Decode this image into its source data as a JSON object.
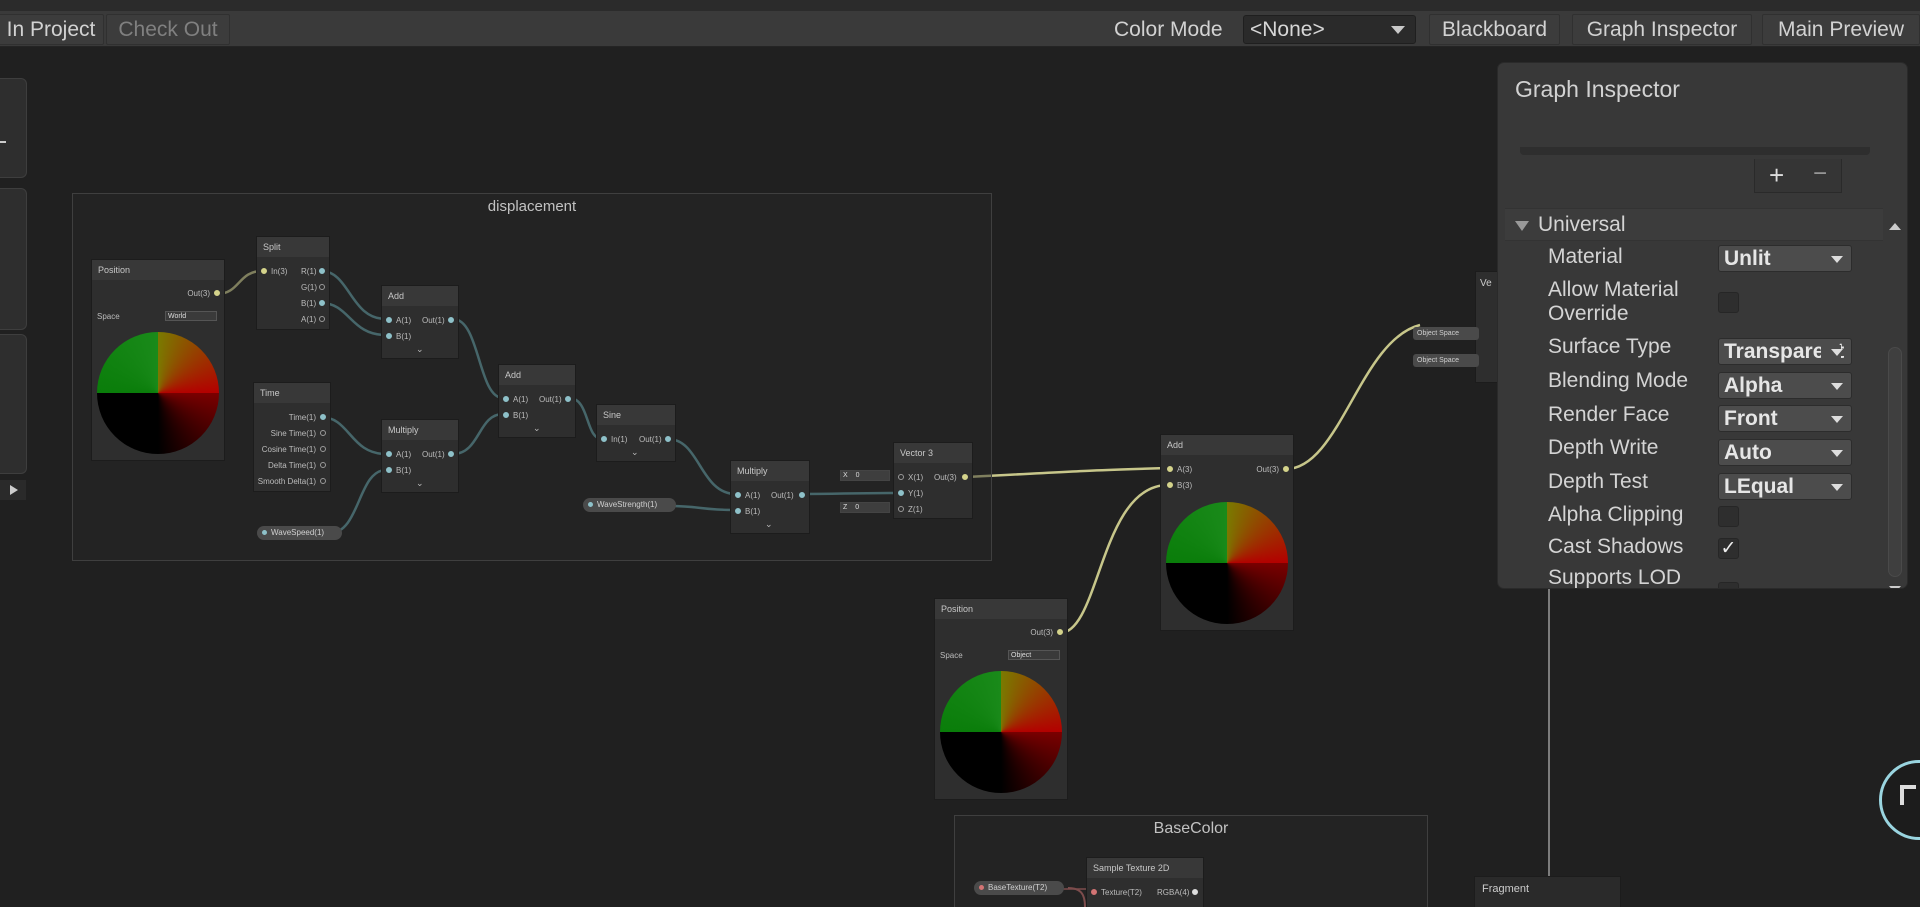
{
  "toolbar": {
    "save_in_project": "In Project",
    "check_out": "Check Out",
    "color_mode_label": "Color Mode",
    "color_mode_value": "<None>",
    "blackboard": "Blackboard",
    "graph_inspector": "Graph Inspector",
    "main_preview": "Main Preview"
  },
  "groups": {
    "displacement": "displacement",
    "basecolor": "BaseColor"
  },
  "nodes": {
    "position1": {
      "title": "Position",
      "out": "Out(3)",
      "space_label": "Space",
      "space_value": "World"
    },
    "split": {
      "title": "Split",
      "in": "In(3)",
      "outs": [
        "R(1)",
        "G(1)",
        "B(1)",
        "A(1)"
      ]
    },
    "add1": {
      "title": "Add",
      "a": "A(1)",
      "b": "B(1)",
      "out": "Out(1)"
    },
    "time": {
      "title": "Time",
      "outs": [
        "Time(1)",
        "Sine Time(1)",
        "Cosine Time(1)",
        "Delta Time(1)",
        "Smooth Delta(1)"
      ]
    },
    "multiply1": {
      "title": "Multiply",
      "a": "A(1)",
      "b": "B(1)",
      "out": "Out(1)"
    },
    "add2": {
      "title": "Add",
      "a": "A(1)",
      "b": "B(1)",
      "out": "Out(1)"
    },
    "sine": {
      "title": "Sine",
      "in": "In(1)",
      "out": "Out(1)"
    },
    "multiply2": {
      "title": "Multiply",
      "a": "A(1)",
      "b": "B(1)",
      "out": "Out(1)"
    },
    "vector3": {
      "title": "Vector 3",
      "x": "X(1)",
      "y": "Y(1)",
      "z": "Z(1)",
      "out": "Out(3)",
      "x_label": "X",
      "x_value": "0",
      "z_label": "Z",
      "z_value": "0"
    },
    "wavespeed": "WaveSpeed(1)",
    "wavestrength": "WaveStrength(1)",
    "position2": {
      "title": "Position",
      "out": "Out(3)",
      "space_label": "Space",
      "space_value": "Object"
    },
    "add3": {
      "title": "Add",
      "a": "A(3)",
      "b": "B(3)",
      "out": "Out(3)"
    },
    "vertex_partial": "Ve",
    "object_space_1": "Object Space",
    "object_space_2": "Object Space",
    "sample_texture": {
      "title": "Sample Texture 2D",
      "texture": "Texture(T2)",
      "rgba": "RGBA(4)"
    },
    "basetexture": "BaseTexture(T2)",
    "fragment": "Fragment"
  },
  "inspector": {
    "title": "Graph Inspector",
    "section": "Universal",
    "add": "+",
    "remove": "−",
    "rows": [
      {
        "label": "Material",
        "value": "Unlit",
        "kind": "dropdown"
      },
      {
        "label": "Allow Material",
        "label2": "Override",
        "checked": false,
        "kind": "checkbox"
      },
      {
        "label": "Surface Type",
        "value": "Transparent",
        "kind": "dropdown"
      },
      {
        "label": "Blending Mode",
        "value": "Alpha",
        "kind": "dropdown"
      },
      {
        "label": "Render Face",
        "value": "Front",
        "kind": "dropdown"
      },
      {
        "label": "Depth Write",
        "value": "Auto",
        "kind": "dropdown"
      },
      {
        "label": "Depth Test",
        "value": "LEqual",
        "kind": "dropdown"
      },
      {
        "label": "Alpha Clipping",
        "checked": false,
        "kind": "checkbox"
      },
      {
        "label": "Cast Shadows",
        "checked": true,
        "check_mark": "✓",
        "kind": "checkbox"
      },
      {
        "label": "Supports LOD",
        "checked": false,
        "kind": "checkbox"
      }
    ]
  },
  "colors": {
    "background": "#202020",
    "panel": "#383838",
    "wire_float": "#5f9aa0",
    "wire_vec3": "#c7c68a"
  }
}
